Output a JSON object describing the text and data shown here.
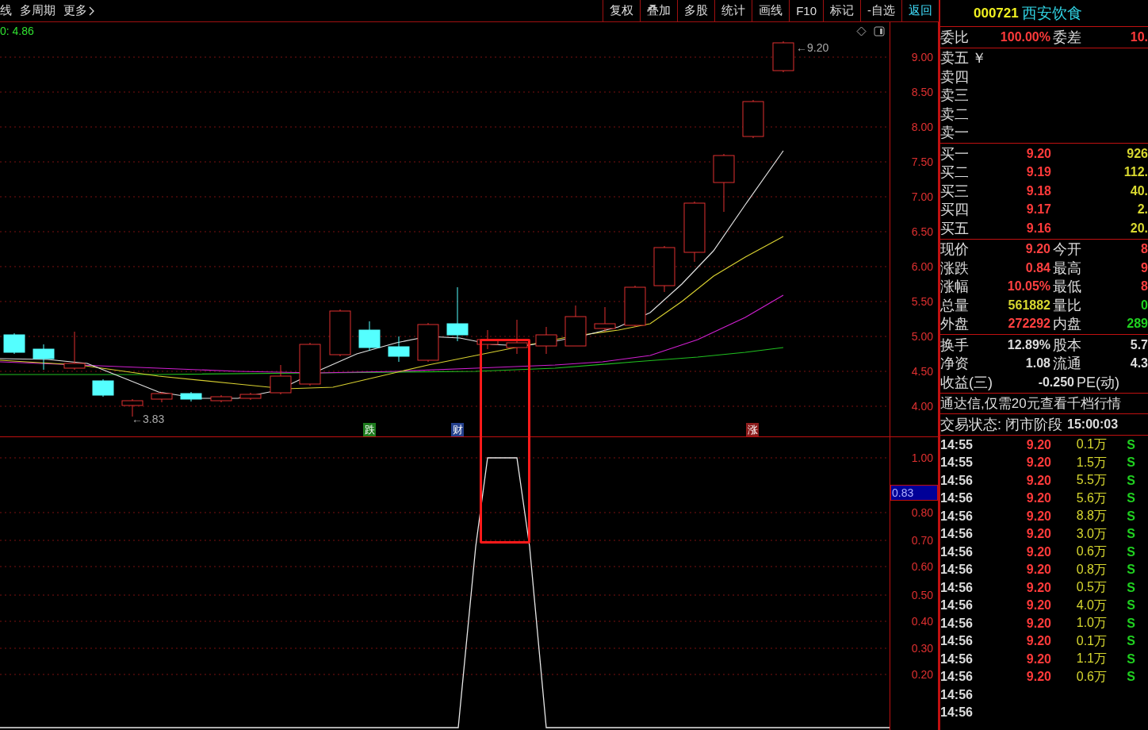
{
  "toolbar": {
    "left_items": [
      "线",
      "多周期",
      "更多"
    ],
    "buttons": [
      {
        "label": "复权",
        "kind": "normal"
      },
      {
        "label": "叠加",
        "kind": "normal"
      },
      {
        "label": "多股",
        "kind": "normal"
      },
      {
        "label": "统计",
        "kind": "normal"
      },
      {
        "label": "画线",
        "kind": "normal"
      },
      {
        "label": "F10",
        "kind": "normal"
      },
      {
        "label": "标记",
        "kind": "normal"
      },
      {
        "label": "-自选",
        "kind": "normal"
      },
      {
        "label": "返回",
        "kind": "back"
      }
    ]
  },
  "main_chart": {
    "legend": "0: 4.86",
    "y_ticks": [
      "9.00",
      "8.50",
      "8.00",
      "7.50",
      "7.00",
      "6.50",
      "6.00",
      "5.50",
      "5.00",
      "4.50",
      "4.00"
    ],
    "high_label": "←9.20",
    "low_label": "←3.83",
    "signals": [
      {
        "label": "跌",
        "color": "#1d7a1d"
      },
      {
        "label": "财",
        "color": "#24408c"
      },
      {
        "label": "涨",
        "color": "#8c1c1c"
      }
    ]
  },
  "indicator_chart": {
    "y_ticks": [
      "1.00",
      "0.80",
      "0.70",
      "0.60",
      "0.50",
      "0.40",
      "0.30",
      "0.20"
    ],
    "current_value": "0.83"
  },
  "quote": {
    "code": "000721",
    "name": "西安饮食",
    "ratio": {
      "label": "委比",
      "value": "100.00%",
      "label2": "委差",
      "value2": "10."
    },
    "sell": [
      {
        "label": "卖五",
        "mark": "￥"
      },
      {
        "label": "卖四"
      },
      {
        "label": "卖三"
      },
      {
        "label": "卖二"
      },
      {
        "label": "卖一"
      }
    ],
    "buy": [
      {
        "label": "买一",
        "price": "9.20",
        "volume": "926"
      },
      {
        "label": "买二",
        "price": "9.19",
        "volume": "112."
      },
      {
        "label": "买三",
        "price": "9.18",
        "volume": "40."
      },
      {
        "label": "买四",
        "price": "9.17",
        "volume": "2."
      },
      {
        "label": "买五",
        "price": "9.16",
        "volume": "20."
      }
    ],
    "stats": [
      [
        {
          "label": "现价",
          "value": "9.20",
          "color": "#ff4040"
        },
        {
          "label": "今开",
          "value": "8",
          "color": "#ff4040"
        }
      ],
      [
        {
          "label": "涨跌",
          "value": "0.84",
          "color": "#ff4040"
        },
        {
          "label": "最高",
          "value": "9",
          "color": "#ff4040"
        }
      ],
      [
        {
          "label": "涨幅",
          "value": "10.05%",
          "color": "#ff4040"
        },
        {
          "label": "最低",
          "value": "8",
          "color": "#ff4040"
        }
      ],
      [
        {
          "label": "总量",
          "value": "561882",
          "color": "#d8d830"
        },
        {
          "label": "量比",
          "value": "0",
          "color": "#20d020"
        }
      ],
      [
        {
          "label": "外盘",
          "value": "272292",
          "color": "#ff4040"
        },
        {
          "label": "内盘",
          "value": "289",
          "color": "#20d020"
        }
      ]
    ],
    "fundamentals": [
      [
        {
          "label": "换手",
          "value": "12.89%"
        },
        {
          "label": "股本",
          "value": "5.7"
        }
      ],
      [
        {
          "label": "净资",
          "value": "1.08"
        },
        {
          "label": "流通",
          "value": "4.3"
        }
      ],
      [
        {
          "label": "收益(三)",
          "value": "-0.250"
        },
        {
          "label": "PE(动)"
        }
      ]
    ],
    "promo": "通达信,仅需20元查看千档行情",
    "status": {
      "label": "交易状态: 闭市阶段",
      "time": "15:00:03"
    },
    "trades": [
      {
        "time": "14:55",
        "price": "9.20",
        "volume": "0.1万",
        "side": "S"
      },
      {
        "time": "14:55",
        "price": "9.20",
        "volume": "1.5万",
        "side": "S"
      },
      {
        "time": "14:56",
        "price": "9.20",
        "volume": "5.5万",
        "side": "S"
      },
      {
        "time": "14:56",
        "price": "9.20",
        "volume": "5.6万",
        "side": "S"
      },
      {
        "time": "14:56",
        "price": "9.20",
        "volume": "8.8万",
        "side": "S"
      },
      {
        "time": "14:56",
        "price": "9.20",
        "volume": "3.0万",
        "side": "S"
      },
      {
        "time": "14:56",
        "price": "9.20",
        "volume": "0.6万",
        "side": "S"
      },
      {
        "time": "14:56",
        "price": "9.20",
        "volume": "0.8万",
        "side": "S"
      },
      {
        "time": "14:56",
        "price": "9.20",
        "volume": "0.5万",
        "side": "S"
      },
      {
        "time": "14:56",
        "price": "9.20",
        "volume": "4.0万",
        "side": "S"
      },
      {
        "time": "14:56",
        "price": "9.20",
        "volume": "1.0万",
        "side": "S"
      },
      {
        "time": "14:56",
        "price": "9.20",
        "volume": "0.1万",
        "side": "S"
      },
      {
        "time": "14:56",
        "price": "9.20",
        "volume": "1.1万",
        "side": "S"
      },
      {
        "time": "14:56",
        "price": "9.20",
        "volume": "0.6万",
        "side": "S"
      },
      {
        "time": "14:56"
      },
      {
        "time": "14:56"
      }
    ]
  }
}
